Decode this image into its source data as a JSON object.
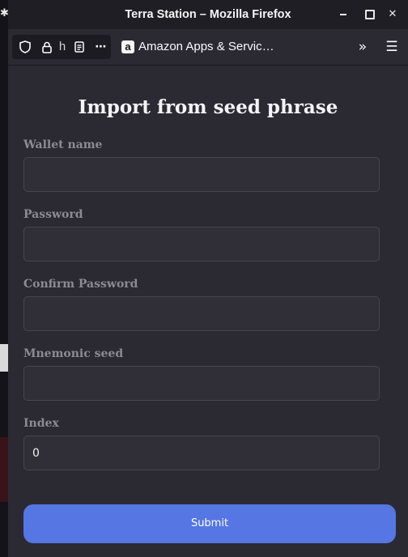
{
  "window": {
    "title": "Terra Station – Mozilla Firefox"
  },
  "toolbar": {
    "url_visible": "h",
    "tab_label": "Amazon Apps & Servic…",
    "favicon_letter": "a"
  },
  "form": {
    "heading": "Import from seed phrase",
    "fields": [
      {
        "label": "Wallet name",
        "value": ""
      },
      {
        "label": "Password",
        "value": ""
      },
      {
        "label": "Confirm Password",
        "value": ""
      },
      {
        "label": "Mnemonic seed",
        "value": ""
      },
      {
        "label": "Index",
        "value": "0"
      }
    ],
    "submit_label": "Submit"
  },
  "colors": {
    "accent": "#5576e3",
    "background": "#2b2a33",
    "titlebar": "#1f1e25"
  }
}
